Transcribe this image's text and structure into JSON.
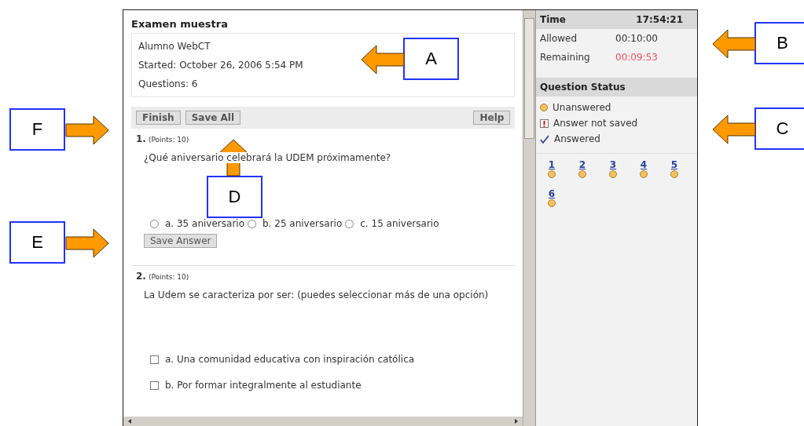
{
  "exam": {
    "title": "Examen muestra",
    "student": "Alumno WebCT",
    "started": "Started: October 26, 2006 5:54 PM",
    "questions": "Questions: 6"
  },
  "toolbar": {
    "buttons": [
      "Finish",
      "Save All"
    ],
    "help": "Help"
  },
  "questions": [
    {
      "number": "1.",
      "points": "(Points: 10)",
      "text": "¿Qué aniversario celebrará la UDEM próximamente?",
      "kind": "radio",
      "options": [
        {
          "label": "a. 35 aniversario",
          "selected": false
        },
        {
          "label": "b. 25 aniversario",
          "selected": false
        },
        {
          "label": "c. 15 aniversario",
          "selected": false
        }
      ],
      "save_button": "Save Answer"
    },
    {
      "number": "2.",
      "points": "(Points: 10)",
      "text": "La Udem se caracteriza por ser: (puedes seleccionar más de una opción)",
      "kind": "checkbox",
      "options": [
        {
          "label": "a. Una comunidad educativa con inspiración católica",
          "checked": false
        },
        {
          "label": "b. Por formar integralmente al estudiante",
          "checked": false
        }
      ]
    }
  ],
  "sidebar": {
    "time_label": "Time",
    "time": "17:54:21",
    "allowed_label": "Allowed",
    "allowed": "00:10:00",
    "remaining_label": "Remaining",
    "remaining": "00:09:53",
    "status_title": "Question Status",
    "legend": [
      {
        "kind": "unanswered",
        "label": "Unanswered"
      },
      {
        "kind": "not_saved",
        "label": "Answer not saved"
      },
      {
        "kind": "answered",
        "label": "Answered"
      }
    ],
    "question_links": [
      {
        "label": "1"
      },
      {
        "label": "2"
      },
      {
        "label": "3"
      },
      {
        "label": "4"
      },
      {
        "label": "5"
      },
      {
        "label": "6"
      }
    ]
  },
  "callouts": [
    {
      "label": "A"
    },
    {
      "label": "B"
    },
    {
      "label": "C"
    },
    {
      "label": "D"
    },
    {
      "label": "E"
    },
    {
      "label": "F"
    }
  ]
}
